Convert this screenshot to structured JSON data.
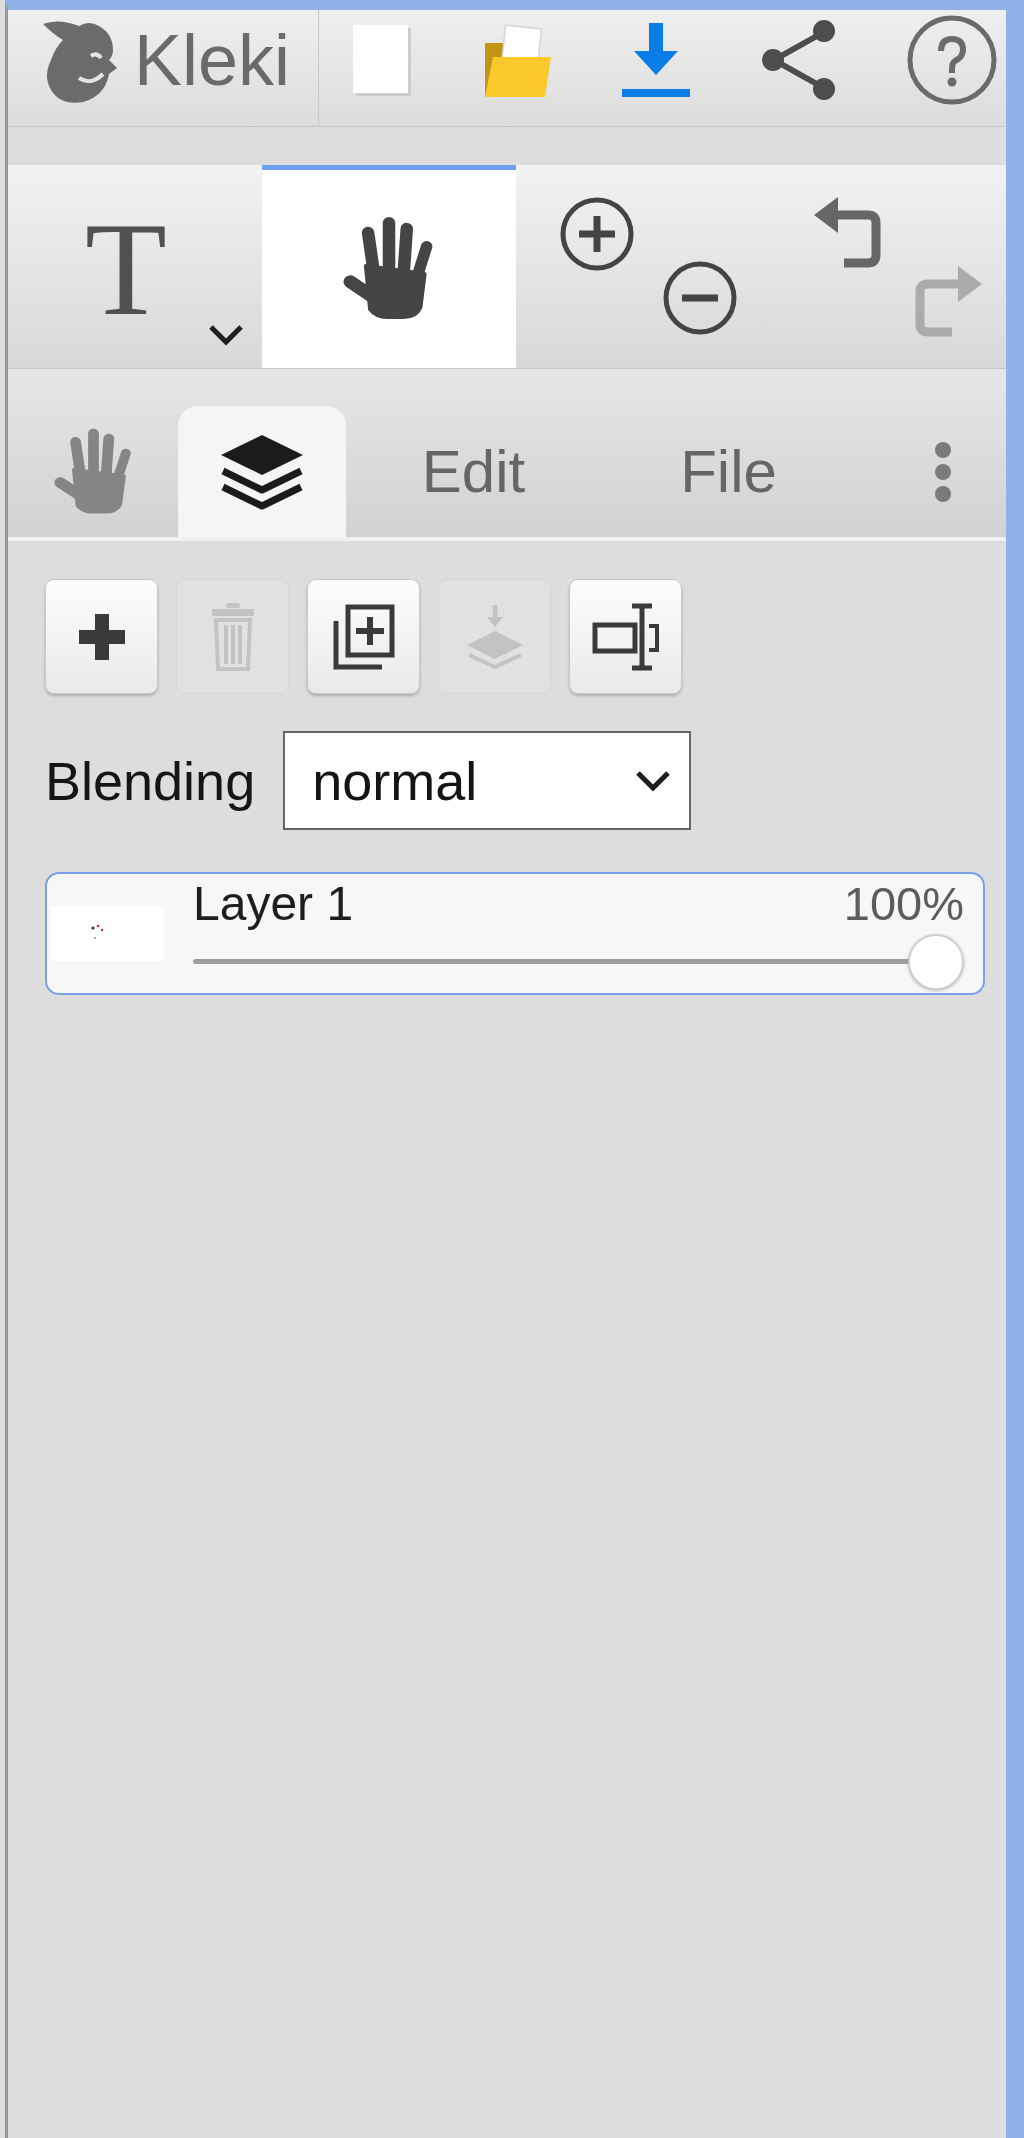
{
  "top_bar": {
    "logo": "Kleki",
    "actions": [
      {
        "kind": "new"
      },
      {
        "kind": "open"
      },
      {
        "kind": "save"
      },
      {
        "kind": "share"
      },
      {
        "kind": "help"
      }
    ]
  },
  "tools": [
    {
      "kind": "text",
      "glyph": "T",
      "selected": false
    },
    {
      "kind": "hand",
      "selected": true
    }
  ],
  "view": [
    {
      "kind": "zoom_in"
    },
    {
      "kind": "zoom_out"
    }
  ],
  "history": [
    {
      "kind": "undo",
      "disabled": false
    },
    {
      "kind": "redo",
      "disabled": true
    }
  ],
  "tabs": [
    {
      "kind": "hand",
      "selected": false
    },
    {
      "kind": "layers",
      "selected": true
    },
    {
      "kind": "label",
      "label": "Edit",
      "selected": false
    },
    {
      "kind": "label",
      "label": "File",
      "selected": false
    }
  ],
  "layers_panel": {
    "actions": [
      {
        "kind": "add",
        "disabled": false
      },
      {
        "kind": "delete",
        "disabled": true
      },
      {
        "kind": "duplicate",
        "disabled": false
      },
      {
        "kind": "merge_down",
        "disabled": true
      },
      {
        "kind": "rename",
        "disabled": false
      }
    ],
    "blending": {
      "label": "Blending",
      "value": "normal"
    },
    "layers": [
      {
        "name": "Layer 1",
        "opacity": "100%",
        "level": 1,
        "selected": true
      }
    ]
  }
}
